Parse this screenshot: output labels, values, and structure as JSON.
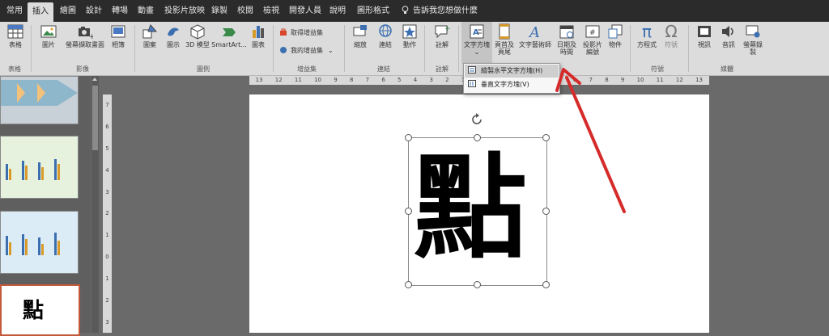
{
  "tabs": [
    "常用",
    "插入",
    "繪圖",
    "設計",
    "轉場",
    "動畫",
    "投影片放映",
    "錄製",
    "校閱",
    "檢視",
    "開發人員",
    "說明",
    "圖形格式"
  ],
  "tell_me": "告訴我您想做什麼",
  "ribbon": {
    "groups": [
      {
        "label": "表格",
        "buttons": [
          "表格"
        ]
      },
      {
        "label": "影像",
        "buttons": [
          "圖片",
          "螢幕擷取畫面",
          "相簿"
        ]
      },
      {
        "label": "圖例",
        "buttons": [
          "圖案",
          "圖示",
          "3D 模型",
          "SmartArt...",
          "圖表"
        ]
      },
      {
        "label": "增益集",
        "buttons": [
          "取得增益集",
          "我的增益集"
        ]
      },
      {
        "label": "連結",
        "buttons": [
          "縮放",
          "連結",
          "動作"
        ]
      },
      {
        "label": "註解",
        "buttons": [
          "註解"
        ]
      },
      {
        "label": "",
        "buttons": [
          "文字方塊",
          "頁首及頁尾",
          "文字藝術師",
          "日期及時間",
          "投影片編號",
          "物件"
        ]
      },
      {
        "label": "符號",
        "buttons": [
          "方程式",
          "符號"
        ]
      },
      {
        "label": "媒體",
        "buttons": [
          "視訊",
          "音訊",
          "螢幕錄製"
        ]
      }
    ]
  },
  "dropdown": {
    "items": [
      "繪製水平文字方塊(H)",
      "垂直文字方塊(V)"
    ]
  },
  "slide": {
    "text": "點"
  },
  "thumbnails": [
    {
      "type": "diagram"
    },
    {
      "type": "chart-green"
    },
    {
      "type": "chart-blue"
    },
    {
      "type": "text",
      "text": "點"
    }
  ],
  "ruler": {
    "h_ticks": [
      "13",
      "12",
      "11",
      "10",
      "9",
      "8",
      "7",
      "6",
      "5",
      "4",
      "3",
      "2",
      "1",
      "0",
      "1",
      "2",
      "3",
      "4",
      "5",
      "6",
      "7",
      "8",
      "9",
      "10",
      "11",
      "12",
      "13"
    ],
    "v_ticks": [
      "7",
      "6",
      "5",
      "4",
      "3",
      "2",
      "1",
      "0",
      "1",
      "2",
      "3"
    ]
  },
  "colors": {
    "accent_arrow": "#d62b2b",
    "tab_bar": "#2b2b2b",
    "ribbon": "#dcdcdc"
  }
}
